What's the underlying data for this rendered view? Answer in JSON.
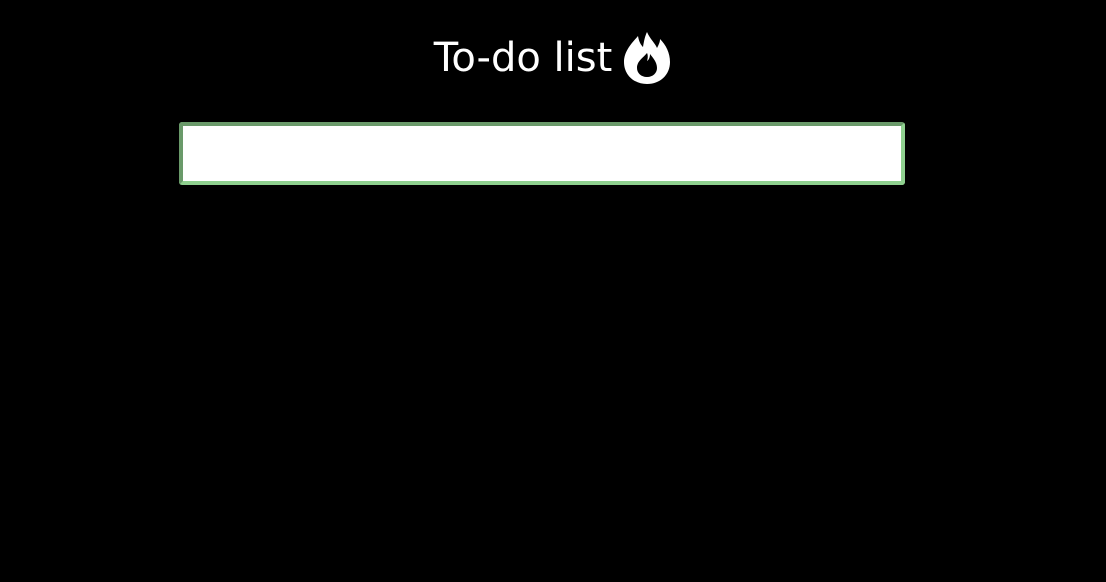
{
  "header": {
    "title": "To-do list",
    "icon": "flame-icon"
  },
  "todo_input": {
    "value": "",
    "placeholder": ""
  },
  "colors": {
    "background": "#000000",
    "text": "#ffffff",
    "input_border": "#8fd08f",
    "input_background": "#ffffff"
  }
}
